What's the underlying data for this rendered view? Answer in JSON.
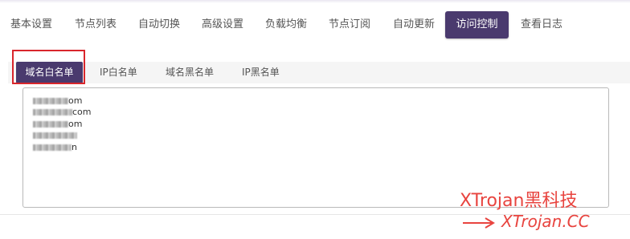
{
  "nav": {
    "tabs": [
      {
        "label": "基本设置"
      },
      {
        "label": "节点列表"
      },
      {
        "label": "自动切换"
      },
      {
        "label": "高级设置"
      },
      {
        "label": "负载均衡"
      },
      {
        "label": "节点订阅"
      },
      {
        "label": "自动更新"
      },
      {
        "label": "访问控制",
        "active": true
      },
      {
        "label": "查看日志"
      }
    ]
  },
  "subtabs": [
    {
      "label": "域名白名单",
      "active": true
    },
    {
      "label": "IP白名单"
    },
    {
      "label": "域名黑名单"
    },
    {
      "label": "IP黑名单"
    }
  ],
  "domain_list": {
    "lines": [
      {
        "visible_suffix": "om"
      },
      {
        "visible_suffix": "com"
      },
      {
        "visible_suffix": "om"
      },
      {
        "visible_suffix": ""
      },
      {
        "visible_suffix": "n"
      }
    ]
  },
  "watermark": {
    "brand": "XTrojan黑科技",
    "site": "XTrojan.CC"
  },
  "colors": {
    "accent": "#4a3a6e",
    "highlight": "#d9262c",
    "watermark": "#e8443f"
  }
}
